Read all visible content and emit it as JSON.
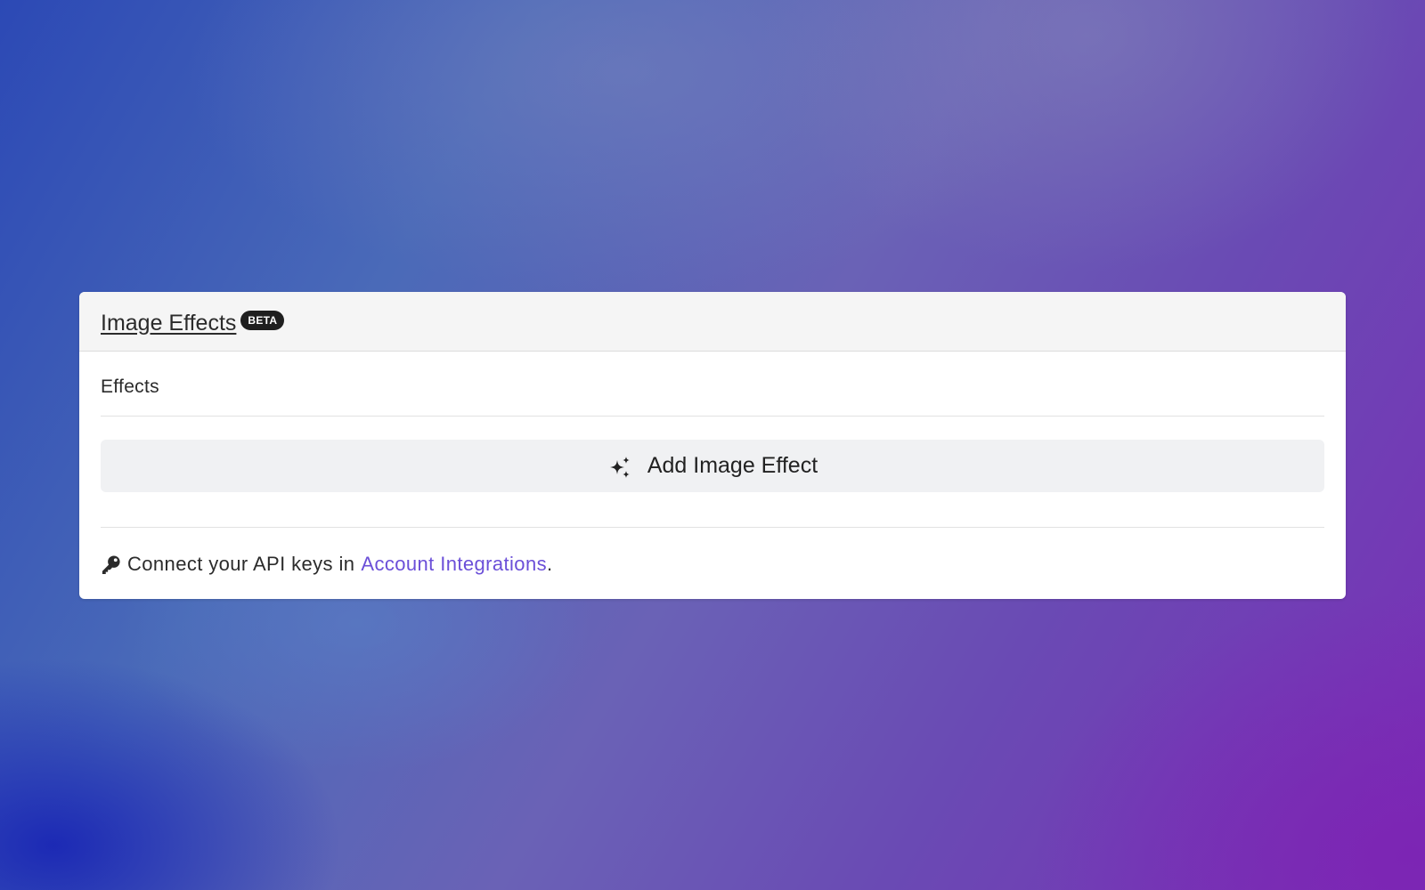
{
  "panel": {
    "title": "Image Effects",
    "badge": "BETA",
    "section_label": "Effects",
    "add_button_label": "Add Image Effect",
    "add_button_icon": "sparkles-icon",
    "footer": {
      "icon": "key-icon",
      "text_before": "Connect your API keys in",
      "link_text": "Account Integrations",
      "text_after": "."
    }
  },
  "colors": {
    "link": "#6b4fd8",
    "badge_bg": "#1f1f1f",
    "button_bg": "#f0f1f3",
    "header_bg": "#f5f5f5"
  }
}
